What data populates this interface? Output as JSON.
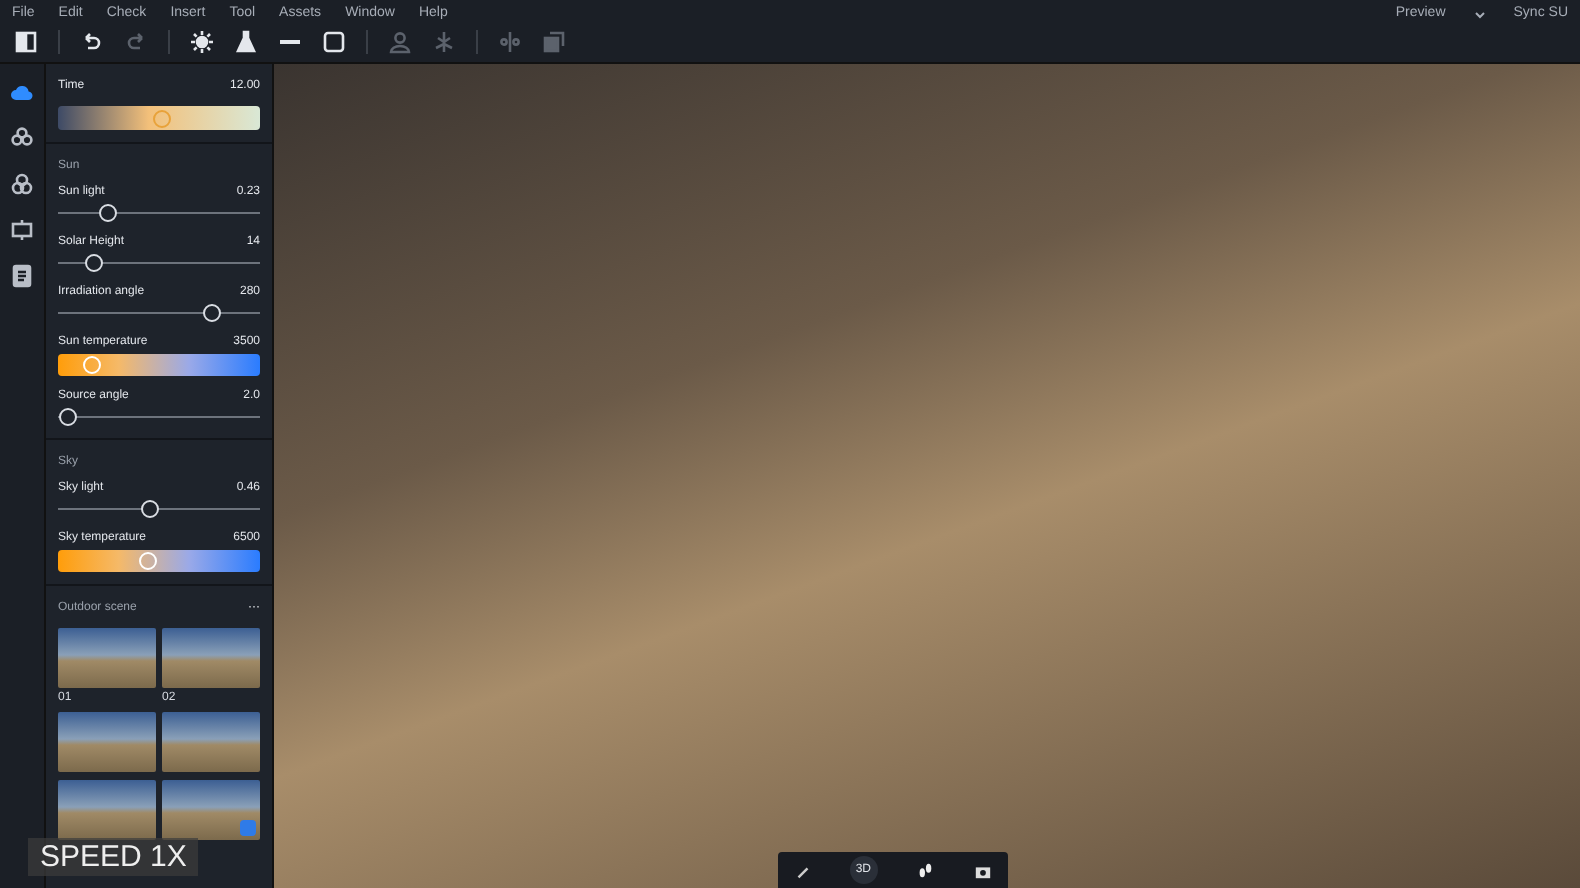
{
  "menu": [
    "File",
    "Edit",
    "Check",
    "Insert",
    "Tool",
    "Assets",
    "Window",
    "Help"
  ],
  "top_right": {
    "preview": "Preview",
    "sync": "Sync SU"
  },
  "toolbar": [
    {
      "kind": "panel",
      "disabled": false
    },
    {
      "kind": "undo",
      "disabled": false
    },
    {
      "kind": "redo",
      "disabled": true
    },
    {
      "kind": "sun",
      "disabled": false
    },
    {
      "kind": "flask",
      "disabled": false
    },
    {
      "kind": "line",
      "disabled": false
    },
    {
      "kind": "frame",
      "disabled": false
    },
    {
      "kind": "person",
      "disabled": true
    },
    {
      "kind": "tree",
      "disabled": true
    },
    {
      "kind": "mirror",
      "disabled": true
    },
    {
      "kind": "copy",
      "disabled": true
    }
  ],
  "rail": [
    {
      "kind": "cloud",
      "selected": true
    },
    {
      "kind": "flower",
      "selected": false
    },
    {
      "kind": "clover",
      "selected": false
    },
    {
      "kind": "camera",
      "selected": false
    },
    {
      "kind": "list",
      "selected": false
    }
  ],
  "time": {
    "label": "Time",
    "value": "12.00",
    "level": 0.51
  },
  "sections": [
    {
      "title": "Sun",
      "controls": [
        {
          "kind": "slider",
          "label": "Sun light",
          "value": "0.23",
          "level": 0.25
        },
        {
          "kind": "slider",
          "label": "Solar Height",
          "value": "14",
          "level": 0.18
        },
        {
          "kind": "slider",
          "label": "Irradiation angle",
          "value": "280",
          "level": 0.76
        },
        {
          "kind": "gradient",
          "label": "Sun temperature",
          "value": "3500",
          "level": 0.17
        },
        {
          "kind": "slider",
          "label": "Source angle",
          "value": "2.0",
          "level": 0.05
        }
      ]
    },
    {
      "title": "Sky",
      "controls": [
        {
          "kind": "slider",
          "label": "Sky light",
          "value": "0.46",
          "level": 0.46
        },
        {
          "kind": "gradient",
          "label": "Sky temperature",
          "value": "6500",
          "level": 0.45
        }
      ]
    }
  ],
  "scenes": {
    "title": "Outdoor scene",
    "more": "···",
    "items": [
      {
        "label": "01",
        "selected": false
      },
      {
        "label": "02",
        "selected": false
      },
      {
        "selected": false
      },
      {
        "selected": false
      },
      {
        "selected": false
      },
      {
        "selected": true
      }
    ]
  },
  "speed": "SPEED 1X",
  "bottom_bar": {
    "mode": "3D"
  }
}
